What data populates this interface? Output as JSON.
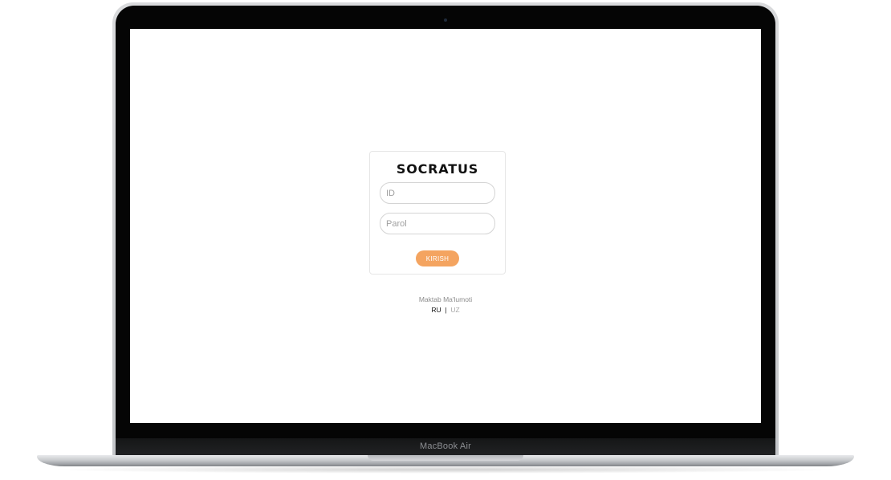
{
  "device": {
    "label": "MacBook Air"
  },
  "login": {
    "logo": "SOCRATUS",
    "id_placeholder": "ID",
    "id_value": "",
    "password_placeholder": "Parol",
    "password_value": "",
    "submit_label": "KIRISH",
    "accent_color": "#f4a460"
  },
  "footer": {
    "school_info_label": "Maktab Ma'lumoti",
    "languages": [
      {
        "code": "RU",
        "active": true
      },
      {
        "code": "UZ",
        "active": false
      }
    ],
    "separator": "|"
  }
}
